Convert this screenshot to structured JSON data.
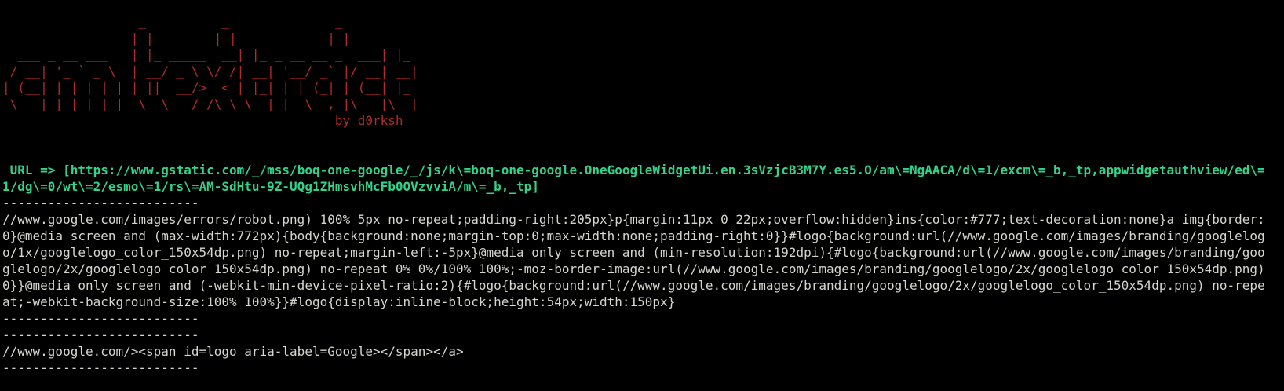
{
  "banner": {
    "ascii_art": "                  _          _              _\n                 | |        | |            | |\n  ___ _ __ ___   | |_ _____  __| |_ _ __ __ _  ___| |_\n / __| '_ ` _ \\  | __/ _ \\ \\/ /| __| '__/ _` |/ __| __|\n| (__| | | | | | | ||  __/>  < | |_| | | (_| | (__| |_\n \\___|_| |_| |_|  \\__\\___/_/\\_\\ \\__|_|  \\__,_|\\___|\\__|",
    "byline": "                                            by d0rksh"
  },
  "url_line": " URL => [https://www.gstatic.com/_/mss/boq-one-google/_/js/k\\=boq-one-google.OneGoogleWidgetUi.en.3sVzjcB3M7Y.es5.O/am\\=NgAACA/d\\=1/excm\\=_b,_tp,appwidgetauthview/ed\\=1/dg\\=0/wt\\=2/esmo\\=1/rs\\=AM-SdHtu-9Z-UQg1ZHmsvhMcFb0OVzvviA/m\\=_b,_tp]",
  "separator": "--------------------------",
  "block1": "//www.google.com/images/errors/robot.png) 100% 5px no-repeat;padding-right:205px}p{margin:11px 0 22px;overflow:hidden}ins{color:#777;text-decoration:none}a img{border:0}@media screen and (max-width:772px){body{background:none;margin-top:0;max-width:none;padding-right:0}}#logo{background:url(//www.google.com/images/branding/googlelogo/1x/googlelogo_color_150x54dp.png) no-repeat;margin-left:-5px}@media only screen and (min-resolution:192dpi){#logo{background:url(//www.google.com/images/branding/googlelogo/2x/googlelogo_color_150x54dp.png) no-repeat 0% 0%/100% 100%;-moz-border-image:url(//www.google.com/images/branding/googlelogo/2x/googlelogo_color_150x54dp.png) 0}}@media only screen and (-webkit-min-device-pixel-ratio:2){#logo{background:url(//www.google.com/images/branding/googlelogo/2x/googlelogo_color_150x54dp.png) no-repeat;-webkit-background-size:100% 100%}}#logo{display:inline-block;height:54px;width:150px}",
  "block2": "//www.google.com/><span id=logo aria-label=Google></span></a>",
  "colors": {
    "background": "#000000",
    "banner": "#b52a2a",
    "url": "#2fd38b",
    "text": "#d3d7cf"
  }
}
